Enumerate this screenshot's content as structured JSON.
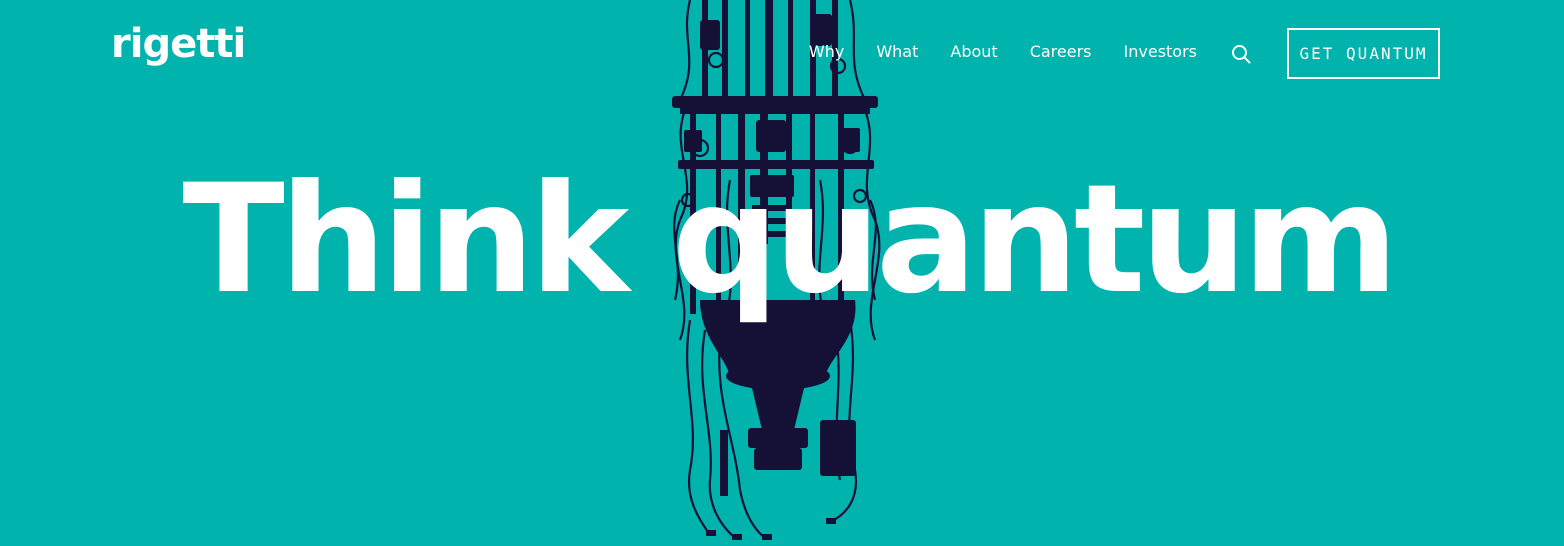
{
  "brand": {
    "logo_text": "rigetti",
    "background_color": "#00b3ad",
    "art_color": "#141036",
    "text_color": "#ffffff"
  },
  "nav": {
    "items": [
      {
        "label": "Why"
      },
      {
        "label": "What"
      },
      {
        "label": "About"
      },
      {
        "label": "Careers"
      },
      {
        "label": "Investors"
      }
    ],
    "search_icon": "search-icon",
    "cta_label": "GET QUANTUM"
  },
  "hero": {
    "headline": "Think quantum",
    "art": "dilution-refrigerator-silhouette"
  }
}
